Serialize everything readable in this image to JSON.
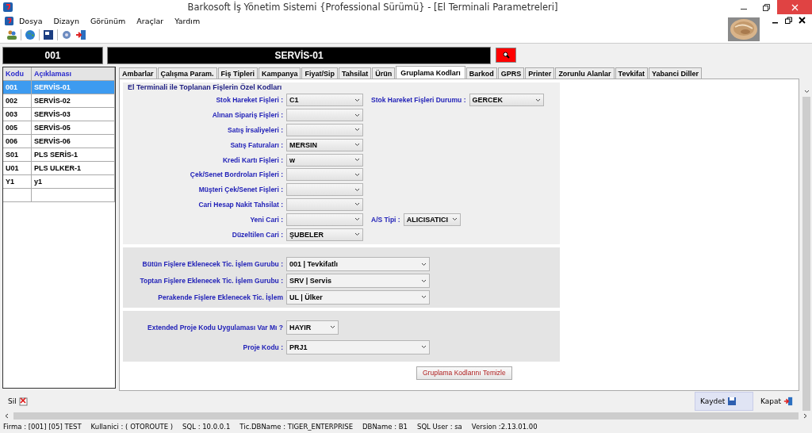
{
  "window": {
    "title": "Barkosoft İş Yönetim Sistemi {Professional Sürümü} - [El Terminali Parametreleri]"
  },
  "menu": [
    "Dosya",
    "Dizayn",
    "Görünüm",
    "Araçlar",
    "Yardım"
  ],
  "header": {
    "code": "001",
    "name": "SERVİS-01"
  },
  "list": {
    "columns": [
      "Kodu",
      "Açıklaması"
    ],
    "rows": [
      {
        "code": "001",
        "name": "SERVİS-01",
        "selected": true
      },
      {
        "code": "002",
        "name": "SERVİS-02",
        "selected": false
      },
      {
        "code": "003",
        "name": "SERVİS-03",
        "selected": false
      },
      {
        "code": "005",
        "name": "SERVİS-05",
        "selected": false
      },
      {
        "code": "006",
        "name": "SERVİS-06",
        "selected": false
      },
      {
        "code": "S01",
        "name": "PLS SERİS-1",
        "selected": false
      },
      {
        "code": "U01",
        "name": "PLS ULKER-1",
        "selected": false
      },
      {
        "code": "Y1",
        "name": "y1",
        "selected": false
      }
    ]
  },
  "tabs": [
    {
      "label": "Ambarlar",
      "selected": false
    },
    {
      "label": "Çalışma Param.",
      "selected": false
    },
    {
      "label": "Fiş Tipleri",
      "selected": false
    },
    {
      "label": "Kampanya",
      "selected": false
    },
    {
      "label": "Fiyat/Sip",
      "selected": false
    },
    {
      "label": "Tahsilat",
      "selected": false
    },
    {
      "label": "Ürün",
      "selected": false
    },
    {
      "label": "Gruplama Kodları",
      "selected": true
    },
    {
      "label": "Barkod",
      "selected": false
    },
    {
      "label": "GPRS",
      "selected": false
    },
    {
      "label": "Printer",
      "selected": false
    },
    {
      "label": "Zorunlu Alanlar",
      "selected": false
    },
    {
      "label": "Tevkifat",
      "selected": false
    },
    {
      "label": "Yabanci Diller",
      "selected": false
    }
  ],
  "section_title": "El Terminali ile Toplanan Fişlerin Özel Kodları",
  "special_codes": [
    {
      "label": "Stok Hareket Fişleri :",
      "value": "C1",
      "side": {
        "label": "Stok Hareket Fişleri Durumu :",
        "value": "GERCEK"
      }
    },
    {
      "label": "Alınan Sipariş Fişleri :"
    },
    {
      "label": "Satış İrsaliyeleri :"
    },
    {
      "label": "Satış Faturaları  :",
      "value": "MERSIN"
    },
    {
      "label": "Kredi Kartı Fişleri :",
      "value": "w"
    },
    {
      "label": "Çek/Senet Bordroları Fişleri :"
    },
    {
      "label": "Müşteri Çek/Senet Fişleri :"
    },
    {
      "label": "Cari Hesap Nakit Tahsilat :"
    },
    {
      "label": "Yeni Cari :",
      "side": {
        "label": "A/S Tipi :",
        "value": "ALICISATICI"
      }
    },
    {
      "label": "Düzeltilen Cari :",
      "value": "ŞUBELER"
    }
  ],
  "transaction_groups": [
    {
      "label": "Bütün Fişlere Eklenecek Tic. İşlem Gurubu :",
      "value": "001 | Tevkifatlı"
    },
    {
      "label": "Toptan Fişlere Eklenecek Tic. İşlem Gurubu :",
      "value": "SRV | Servis"
    },
    {
      "label": "Perakende Fişlere Eklenecek Tic. İşlem",
      "value": "UL | Ülker"
    }
  ],
  "project": [
    {
      "label": "Extended Proje Kodu Uygulaması Var Mı ?",
      "value": "HAYIR",
      "kind": "short"
    },
    {
      "label": "Proje Kodu :",
      "value": "PRJ1",
      "kind": "wide"
    }
  ],
  "clear_button": "Gruplama Kodlarını Temizle",
  "bottom_buttons": {
    "delete": "Sil",
    "save": "Kaydet",
    "close": "Kapat"
  },
  "status_bar": [
    "Firma : [001] [05]  TEST",
    "Kullanici : ( OTOROUTE )",
    "SQL : 10.0.0.1",
    "Tic.DBName : TIGER_ENTERPRISE",
    "DBName : B1",
    "SQL User : sa",
    "Version :2.13.01.00"
  ]
}
